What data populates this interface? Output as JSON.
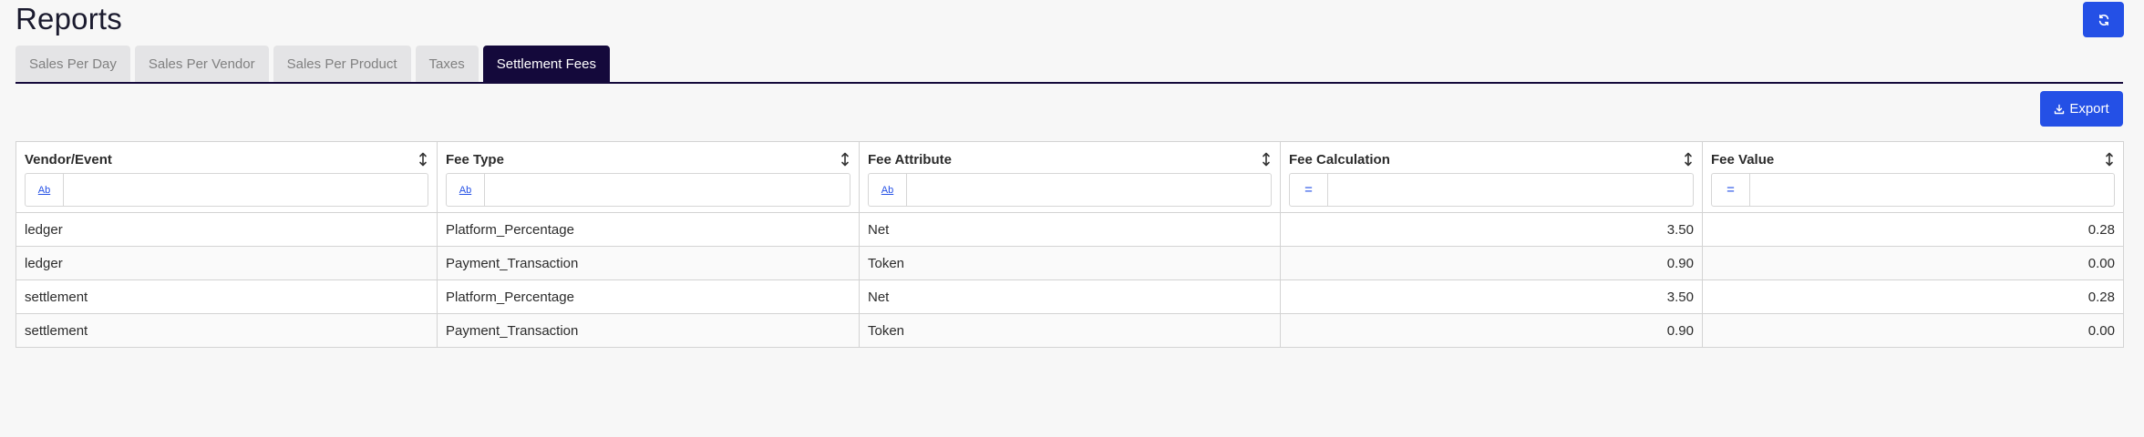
{
  "page": {
    "title": "Reports"
  },
  "header": {
    "refresh_icon": "refresh-icon"
  },
  "tabs": [
    {
      "label": "Sales Per Day",
      "active": false
    },
    {
      "label": "Sales Per Vendor",
      "active": false
    },
    {
      "label": "Sales Per Product",
      "active": false
    },
    {
      "label": "Taxes",
      "active": false
    },
    {
      "label": "Settlement Fees",
      "active": true
    }
  ],
  "toolbar": {
    "export_label": "Export",
    "export_icon": "download-icon"
  },
  "colors": {
    "accent": "#2450e6",
    "active_tab": "#14093b",
    "inactive_tab": "#e4e4e6"
  },
  "table": {
    "columns": [
      {
        "label": "Vendor/Event",
        "filter_op": "Ab",
        "filter_value": ""
      },
      {
        "label": "Fee Type",
        "filter_op": "Ab",
        "filter_value": ""
      },
      {
        "label": "Fee Attribute",
        "filter_op": "Ab",
        "filter_value": ""
      },
      {
        "label": "Fee Calculation",
        "filter_op": "=",
        "filter_value": ""
      },
      {
        "label": "Fee Value",
        "filter_op": "=",
        "filter_value": ""
      }
    ],
    "rows": [
      [
        "ledger",
        "Platform_Percentage",
        "Net",
        "3.50",
        "0.28"
      ],
      [
        "ledger",
        "Payment_Transaction",
        "Token",
        "0.90",
        "0.00"
      ],
      [
        "settlement",
        "Platform_Percentage",
        "Net",
        "3.50",
        "0.28"
      ],
      [
        "settlement",
        "Payment_Transaction",
        "Token",
        "0.90",
        "0.00"
      ]
    ]
  }
}
